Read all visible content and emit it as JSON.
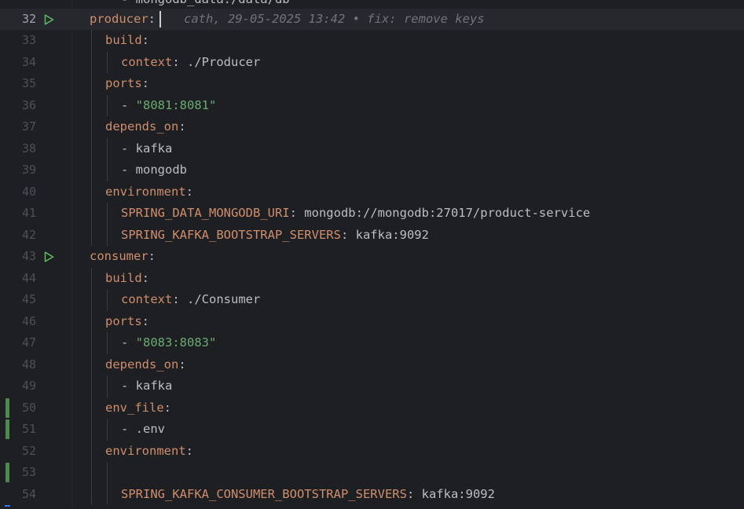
{
  "editor": {
    "partial_top": {
      "text": "- mongodb_data:/data/db"
    },
    "blame": {
      "text": "cath, 29-05-2025 13:42 • fix: remove keys"
    },
    "lines": [
      {
        "num": "32",
        "indent": 1,
        "parts": [
          {
            "t": "key",
            "v": "producer"
          },
          {
            "t": "plain",
            "v": ":"
          }
        ],
        "current": true,
        "run": true
      },
      {
        "num": "33",
        "indent": 2,
        "parts": [
          {
            "t": "key",
            "v": "build"
          },
          {
            "t": "plain",
            "v": ":"
          }
        ]
      },
      {
        "num": "34",
        "indent": 3,
        "parts": [
          {
            "t": "key",
            "v": "context"
          },
          {
            "t": "plain",
            "v": ": ./Producer"
          }
        ]
      },
      {
        "num": "35",
        "indent": 2,
        "parts": [
          {
            "t": "key",
            "v": "ports"
          },
          {
            "t": "plain",
            "v": ":"
          }
        ]
      },
      {
        "num": "36",
        "indent": 3,
        "parts": [
          {
            "t": "plain",
            "v": "- "
          },
          {
            "t": "str",
            "v": "\"8081:8081\""
          }
        ]
      },
      {
        "num": "37",
        "indent": 2,
        "parts": [
          {
            "t": "key",
            "v": "depends_on"
          },
          {
            "t": "plain",
            "v": ":"
          }
        ]
      },
      {
        "num": "38",
        "indent": 3,
        "parts": [
          {
            "t": "plain",
            "v": "- kafka"
          }
        ]
      },
      {
        "num": "39",
        "indent": 3,
        "parts": [
          {
            "t": "plain",
            "v": "- mongodb"
          }
        ]
      },
      {
        "num": "40",
        "indent": 2,
        "parts": [
          {
            "t": "key",
            "v": "environment"
          },
          {
            "t": "plain",
            "v": ":"
          }
        ]
      },
      {
        "num": "41",
        "indent": 3,
        "parts": [
          {
            "t": "key",
            "v": "SPRING_DATA_MONGODB_URI"
          },
          {
            "t": "plain",
            "v": ": mongodb://mongodb:27017/product-service"
          }
        ]
      },
      {
        "num": "42",
        "indent": 3,
        "parts": [
          {
            "t": "key",
            "v": "SPRING_KAFKA_BOOTSTRAP_SERVERS"
          },
          {
            "t": "plain",
            "v": ": kafka:9092"
          }
        ]
      },
      {
        "num": "43",
        "indent": 1,
        "parts": [
          {
            "t": "key",
            "v": "consumer"
          },
          {
            "t": "plain",
            "v": ":"
          }
        ],
        "run": true
      },
      {
        "num": "44",
        "indent": 2,
        "parts": [
          {
            "t": "key",
            "v": "build"
          },
          {
            "t": "plain",
            "v": ":"
          }
        ]
      },
      {
        "num": "45",
        "indent": 3,
        "parts": [
          {
            "t": "key",
            "v": "context"
          },
          {
            "t": "plain",
            "v": ": ./Consumer"
          }
        ]
      },
      {
        "num": "46",
        "indent": 2,
        "parts": [
          {
            "t": "key",
            "v": "ports"
          },
          {
            "t": "plain",
            "v": ":"
          }
        ]
      },
      {
        "num": "47",
        "indent": 3,
        "parts": [
          {
            "t": "plain",
            "v": "- "
          },
          {
            "t": "str",
            "v": "\"8083:8083\""
          }
        ]
      },
      {
        "num": "48",
        "indent": 2,
        "parts": [
          {
            "t": "key",
            "v": "depends_on"
          },
          {
            "t": "plain",
            "v": ":"
          }
        ]
      },
      {
        "num": "49",
        "indent": 3,
        "parts": [
          {
            "t": "plain",
            "v": "- kafka"
          }
        ]
      },
      {
        "num": "50",
        "indent": 2,
        "parts": [
          {
            "t": "key",
            "v": "env_file"
          },
          {
            "t": "plain",
            "v": ":"
          }
        ],
        "changed": true
      },
      {
        "num": "51",
        "indent": 3,
        "parts": [
          {
            "t": "plain",
            "v": "- .env"
          }
        ],
        "changed": true
      },
      {
        "num": "52",
        "indent": 2,
        "parts": [
          {
            "t": "key",
            "v": "environment"
          },
          {
            "t": "plain",
            "v": ":"
          }
        ]
      },
      {
        "num": "53",
        "indent": 3,
        "parts": [],
        "changed": true
      },
      {
        "num": "54",
        "indent": 3,
        "parts": [
          {
            "t": "key",
            "v": "SPRING_KAFKA_CONSUMER_BOOTSTRAP_SERVERS"
          },
          {
            "t": "plain",
            "v": ": kafka:9092"
          }
        ]
      }
    ]
  },
  "icons": {
    "run": "run-gutter-icon",
    "change": "vcs-change-marker"
  },
  "colors": {
    "background": "#1e1f22",
    "current_line": "#26282e",
    "key": "#cf8e6d",
    "string": "#6aab73",
    "text": "#bcbec4",
    "line_number": "#4b5059",
    "run_icon": "#5fb865",
    "change_marker": "#4e8a4e"
  }
}
